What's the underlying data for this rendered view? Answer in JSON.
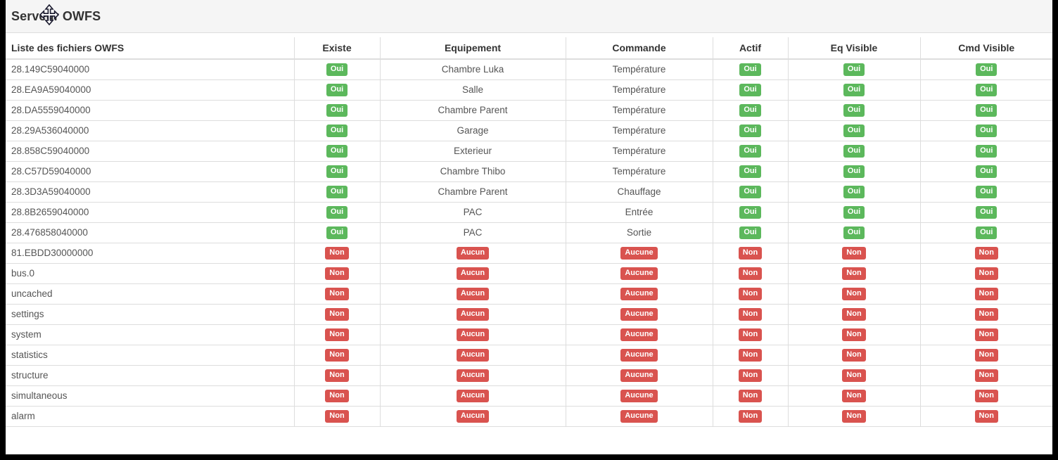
{
  "panel": {
    "title": "Serveur OWFS"
  },
  "cursor": {
    "icon": "move-cursor-icon"
  },
  "colors": {
    "badge_success": "#5cb85c",
    "badge_danger": "#d9534f",
    "panel_heading_bg": "#f5f5f5",
    "border": "#dddddd",
    "header_text": "#333333",
    "body_text": "#555555"
  },
  "table": {
    "columns": [
      "Liste des fichiers OWFS",
      "Existe",
      "Equipement",
      "Commande",
      "Actif",
      "Eq Visible",
      "Cmd Visible"
    ],
    "rows": [
      {
        "file": "28.149C59040000",
        "existe": {
          "text": "Oui",
          "state": "success"
        },
        "equipement": {
          "text": "Chambre Luka",
          "state": "plain"
        },
        "commande": {
          "text": "Température",
          "state": "plain"
        },
        "actif": {
          "text": "Oui",
          "state": "success"
        },
        "eq_visible": {
          "text": "Oui",
          "state": "success"
        },
        "cmd_visible": {
          "text": "Oui",
          "state": "success"
        }
      },
      {
        "file": "28.EA9A59040000",
        "existe": {
          "text": "Oui",
          "state": "success"
        },
        "equipement": {
          "text": "Salle",
          "state": "plain"
        },
        "commande": {
          "text": "Température",
          "state": "plain"
        },
        "actif": {
          "text": "Oui",
          "state": "success"
        },
        "eq_visible": {
          "text": "Oui",
          "state": "success"
        },
        "cmd_visible": {
          "text": "Oui",
          "state": "success"
        }
      },
      {
        "file": "28.DA5559040000",
        "existe": {
          "text": "Oui",
          "state": "success"
        },
        "equipement": {
          "text": "Chambre Parent",
          "state": "plain"
        },
        "commande": {
          "text": "Température",
          "state": "plain"
        },
        "actif": {
          "text": "Oui",
          "state": "success"
        },
        "eq_visible": {
          "text": "Oui",
          "state": "success"
        },
        "cmd_visible": {
          "text": "Oui",
          "state": "success"
        }
      },
      {
        "file": "28.29A536040000",
        "existe": {
          "text": "Oui",
          "state": "success"
        },
        "equipement": {
          "text": "Garage",
          "state": "plain"
        },
        "commande": {
          "text": "Température",
          "state": "plain"
        },
        "actif": {
          "text": "Oui",
          "state": "success"
        },
        "eq_visible": {
          "text": "Oui",
          "state": "success"
        },
        "cmd_visible": {
          "text": "Oui",
          "state": "success"
        }
      },
      {
        "file": "28.858C59040000",
        "existe": {
          "text": "Oui",
          "state": "success"
        },
        "equipement": {
          "text": "Exterieur",
          "state": "plain"
        },
        "commande": {
          "text": "Température",
          "state": "plain"
        },
        "actif": {
          "text": "Oui",
          "state": "success"
        },
        "eq_visible": {
          "text": "Oui",
          "state": "success"
        },
        "cmd_visible": {
          "text": "Oui",
          "state": "success"
        }
      },
      {
        "file": "28.C57D59040000",
        "existe": {
          "text": "Oui",
          "state": "success"
        },
        "equipement": {
          "text": "Chambre Thibo",
          "state": "plain"
        },
        "commande": {
          "text": "Température",
          "state": "plain"
        },
        "actif": {
          "text": "Oui",
          "state": "success"
        },
        "eq_visible": {
          "text": "Oui",
          "state": "success"
        },
        "cmd_visible": {
          "text": "Oui",
          "state": "success"
        }
      },
      {
        "file": "28.3D3A59040000",
        "existe": {
          "text": "Oui",
          "state": "success"
        },
        "equipement": {
          "text": "Chambre Parent",
          "state": "plain"
        },
        "commande": {
          "text": "Chauffage",
          "state": "plain"
        },
        "actif": {
          "text": "Oui",
          "state": "success"
        },
        "eq_visible": {
          "text": "Oui",
          "state": "success"
        },
        "cmd_visible": {
          "text": "Oui",
          "state": "success"
        }
      },
      {
        "file": "28.8B2659040000",
        "existe": {
          "text": "Oui",
          "state": "success"
        },
        "equipement": {
          "text": "PAC",
          "state": "plain"
        },
        "commande": {
          "text": "Entrée",
          "state": "plain"
        },
        "actif": {
          "text": "Oui",
          "state": "success"
        },
        "eq_visible": {
          "text": "Oui",
          "state": "success"
        },
        "cmd_visible": {
          "text": "Oui",
          "state": "success"
        }
      },
      {
        "file": "28.476858040000",
        "existe": {
          "text": "Oui",
          "state": "success"
        },
        "equipement": {
          "text": "PAC",
          "state": "plain"
        },
        "commande": {
          "text": "Sortie",
          "state": "plain"
        },
        "actif": {
          "text": "Oui",
          "state": "success"
        },
        "eq_visible": {
          "text": "Oui",
          "state": "success"
        },
        "cmd_visible": {
          "text": "Oui",
          "state": "success"
        }
      },
      {
        "file": "81.EBDD30000000",
        "existe": {
          "text": "Non",
          "state": "danger"
        },
        "equipement": {
          "text": "Aucun",
          "state": "danger"
        },
        "commande": {
          "text": "Aucune",
          "state": "danger"
        },
        "actif": {
          "text": "Non",
          "state": "danger"
        },
        "eq_visible": {
          "text": "Non",
          "state": "danger"
        },
        "cmd_visible": {
          "text": "Non",
          "state": "danger"
        }
      },
      {
        "file": "bus.0",
        "existe": {
          "text": "Non",
          "state": "danger"
        },
        "equipement": {
          "text": "Aucun",
          "state": "danger"
        },
        "commande": {
          "text": "Aucune",
          "state": "danger"
        },
        "actif": {
          "text": "Non",
          "state": "danger"
        },
        "eq_visible": {
          "text": "Non",
          "state": "danger"
        },
        "cmd_visible": {
          "text": "Non",
          "state": "danger"
        }
      },
      {
        "file": "uncached",
        "existe": {
          "text": "Non",
          "state": "danger"
        },
        "equipement": {
          "text": "Aucun",
          "state": "danger"
        },
        "commande": {
          "text": "Aucune",
          "state": "danger"
        },
        "actif": {
          "text": "Non",
          "state": "danger"
        },
        "eq_visible": {
          "text": "Non",
          "state": "danger"
        },
        "cmd_visible": {
          "text": "Non",
          "state": "danger"
        }
      },
      {
        "file": "settings",
        "existe": {
          "text": "Non",
          "state": "danger"
        },
        "equipement": {
          "text": "Aucun",
          "state": "danger"
        },
        "commande": {
          "text": "Aucune",
          "state": "danger"
        },
        "actif": {
          "text": "Non",
          "state": "danger"
        },
        "eq_visible": {
          "text": "Non",
          "state": "danger"
        },
        "cmd_visible": {
          "text": "Non",
          "state": "danger"
        }
      },
      {
        "file": "system",
        "existe": {
          "text": "Non",
          "state": "danger"
        },
        "equipement": {
          "text": "Aucun",
          "state": "danger"
        },
        "commande": {
          "text": "Aucune",
          "state": "danger"
        },
        "actif": {
          "text": "Non",
          "state": "danger"
        },
        "eq_visible": {
          "text": "Non",
          "state": "danger"
        },
        "cmd_visible": {
          "text": "Non",
          "state": "danger"
        }
      },
      {
        "file": "statistics",
        "existe": {
          "text": "Non",
          "state": "danger"
        },
        "equipement": {
          "text": "Aucun",
          "state": "danger"
        },
        "commande": {
          "text": "Aucune",
          "state": "danger"
        },
        "actif": {
          "text": "Non",
          "state": "danger"
        },
        "eq_visible": {
          "text": "Non",
          "state": "danger"
        },
        "cmd_visible": {
          "text": "Non",
          "state": "danger"
        }
      },
      {
        "file": "structure",
        "existe": {
          "text": "Non",
          "state": "danger"
        },
        "equipement": {
          "text": "Aucun",
          "state": "danger"
        },
        "commande": {
          "text": "Aucune",
          "state": "danger"
        },
        "actif": {
          "text": "Non",
          "state": "danger"
        },
        "eq_visible": {
          "text": "Non",
          "state": "danger"
        },
        "cmd_visible": {
          "text": "Non",
          "state": "danger"
        }
      },
      {
        "file": "simultaneous",
        "existe": {
          "text": "Non",
          "state": "danger"
        },
        "equipement": {
          "text": "Aucun",
          "state": "danger"
        },
        "commande": {
          "text": "Aucune",
          "state": "danger"
        },
        "actif": {
          "text": "Non",
          "state": "danger"
        },
        "eq_visible": {
          "text": "Non",
          "state": "danger"
        },
        "cmd_visible": {
          "text": "Non",
          "state": "danger"
        }
      },
      {
        "file": "alarm",
        "existe": {
          "text": "Non",
          "state": "danger"
        },
        "equipement": {
          "text": "Aucun",
          "state": "danger"
        },
        "commande": {
          "text": "Aucune",
          "state": "danger"
        },
        "actif": {
          "text": "Non",
          "state": "danger"
        },
        "eq_visible": {
          "text": "Non",
          "state": "danger"
        },
        "cmd_visible": {
          "text": "Non",
          "state": "danger"
        }
      }
    ]
  }
}
